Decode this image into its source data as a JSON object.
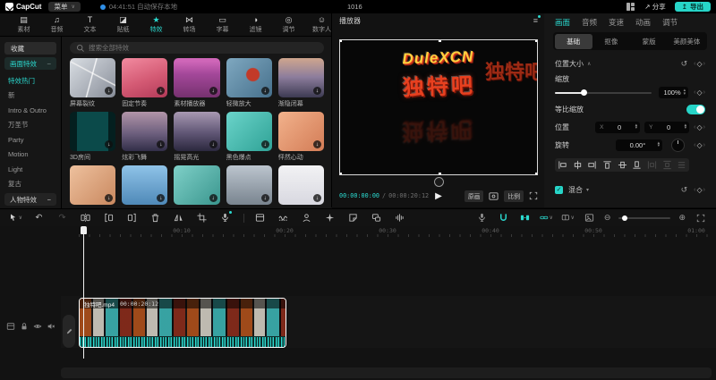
{
  "topbar": {
    "logo_text": "CapCut",
    "menu_label": "菜单",
    "autosave_text": "04:41:51 自动保存本地",
    "center_label": "1016",
    "share_label": "分享",
    "export_label": "导出"
  },
  "ribbon": {
    "items": [
      {
        "label": "素材"
      },
      {
        "label": "音频"
      },
      {
        "label": "文本"
      },
      {
        "label": "贴纸"
      },
      {
        "label": "特效"
      },
      {
        "label": "转场"
      },
      {
        "label": "字幕"
      },
      {
        "label": "滤镜"
      },
      {
        "label": "调节"
      },
      {
        "label": "数字人"
      }
    ]
  },
  "sidebar": {
    "favorites_label": "收藏",
    "group1_label": "画面特效",
    "group2_label": "人物特效",
    "categories": [
      {
        "label": "特效热门"
      },
      {
        "label": "新"
      },
      {
        "label": "Intro & Outro"
      },
      {
        "label": "万圣节"
      },
      {
        "label": "Party"
      },
      {
        "label": "Motion"
      },
      {
        "label": "Light"
      },
      {
        "label": "复古"
      }
    ]
  },
  "effects": {
    "search_placeholder": "搜索全部特效",
    "cards": [
      {
        "label": "屏幕裂纹"
      },
      {
        "label": "固定节奏"
      },
      {
        "label": "素材播放器"
      },
      {
        "label": "轻微放大"
      },
      {
        "label": "渐隐闭幕"
      },
      {
        "label": "3D房间"
      },
      {
        "label": "炫彩飞舞"
      },
      {
        "label": "摇晃高光"
      },
      {
        "label": "黑色爆点"
      },
      {
        "label": "怦然心动"
      }
    ]
  },
  "preview": {
    "title": "播放器",
    "video_text_line1": "DuleXCN",
    "video_text_line2": "独特吧",
    "current_time": "00:00:00:00",
    "time_separator": "/",
    "duration": "00:00:20:12",
    "quality_label": "原画",
    "ratio_label": "比例"
  },
  "inspector": {
    "tabs": [
      {
        "label": "画面"
      },
      {
        "label": "音频"
      },
      {
        "label": "变速"
      },
      {
        "label": "动画"
      },
      {
        "label": "调节"
      }
    ],
    "subtabs": [
      {
        "label": "基础"
      },
      {
        "label": "抠像"
      },
      {
        "label": "蒙版"
      },
      {
        "label": "美颜美体"
      }
    ],
    "position_size_label": "位置大小",
    "scale_label": "缩放",
    "scale_value": "100%",
    "uniform_scale_label": "等比缩放",
    "position_label": "位置",
    "x_label": "X",
    "x_value": "0",
    "y_label": "Y",
    "y_value": "0",
    "rotation_label": "旋转",
    "rotation_value": "0.00°",
    "blend_label": "混合"
  },
  "timeline": {
    "ruler_labels": [
      {
        "t": "00:10"
      },
      {
        "t": "00:20"
      },
      {
        "t": "00:30"
      },
      {
        "t": "00:40"
      },
      {
        "t": "00:50"
      },
      {
        "t": "01:00"
      }
    ],
    "clip_name": "独特吧.mp4",
    "clip_duration": "00:00:20:12"
  },
  "icons": {
    "chevron_down": "∨",
    "collapse": "−",
    "caret_down": "▾",
    "play": "▶",
    "undo": "↶",
    "redo": "↷",
    "reset": "↺",
    "keyframe": "◇",
    "kf_left": "‹",
    "kf_right": "›",
    "download": "↓",
    "check": "✓",
    "share_arrow": "↗",
    "export_arrow": "↥",
    "zoom_out": "⊖",
    "zoom_in": "⊕",
    "menu_lines": "≡",
    "stepper_up": "▴",
    "stepper_down": "▾",
    "media": "▤",
    "audio": "♫",
    "text": "T",
    "sticker": "◪",
    "effects": "★",
    "transition": "⋈",
    "captions": "▭",
    "filter": "◑",
    "adjust": "◎",
    "avatar": "☺"
  },
  "colors": {
    "accent": "#2bd9cf",
    "export_button": "#27d5c8",
    "autosave_dot": "#2f8fe8",
    "panel_bg": "#161616"
  }
}
